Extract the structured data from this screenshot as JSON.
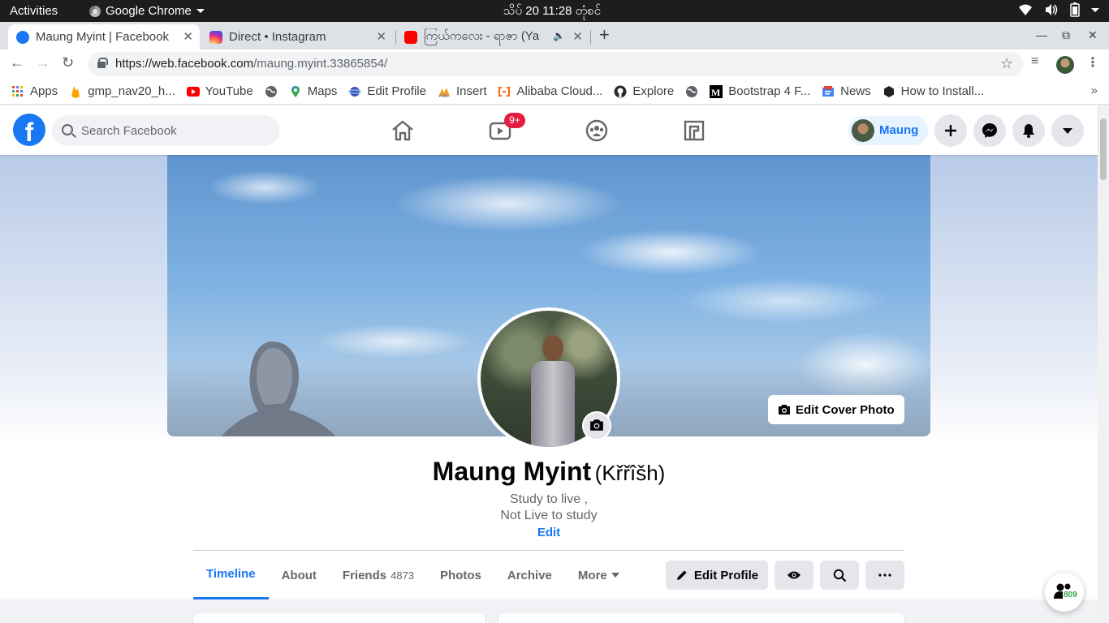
{
  "os_bar": {
    "activities": "Activities",
    "app_name": "Google Chrome",
    "clock": "သိပ် 20  11:28 တုံစင်"
  },
  "tabs": [
    {
      "title": "Maung Myint | Facebook",
      "active": true
    },
    {
      "title": "Direct • Instagram",
      "active": false
    },
    {
      "title": "ကြယ်ကလေး - ရာဇာ (Ya",
      "active": false
    }
  ],
  "address_bar": {
    "url_host": "https://web.facebook.com",
    "url_path": "/maung.myint.33865854/"
  },
  "bookmarks": [
    {
      "label": "Apps",
      "icon": "apps-grid-icon"
    },
    {
      "label": "gmp_nav20_h...",
      "icon": "firebase-icon"
    },
    {
      "label": "YouTube",
      "icon": "youtube-icon"
    },
    {
      "label": "",
      "icon": "globe-icon"
    },
    {
      "label": "Maps",
      "icon": "maps-pin-icon"
    },
    {
      "label": "Edit Profile",
      "icon": "globe-planet-icon"
    },
    {
      "label": "Insert",
      "icon": "pma-icon"
    },
    {
      "label": "Alibaba Cloud...",
      "icon": "alibaba-icon"
    },
    {
      "label": "Explore",
      "icon": "github-icon"
    },
    {
      "label": "",
      "icon": "globe-icon"
    },
    {
      "label": "Bootstrap 4 F...",
      "icon": "medium-icon"
    },
    {
      "label": "News",
      "icon": "google-news-icon"
    },
    {
      "label": "How to Install...",
      "icon": "hexagon-icon"
    }
  ],
  "facebook": {
    "search_placeholder": "Search Facebook",
    "watch_badge": "9+",
    "profile_chip_name": "Maung",
    "brand_color": "#1877f2",
    "profile": {
      "name": "Maung Myint",
      "alternate_name": "(Křřîšh)",
      "bio_line1": "Study to live ,",
      "bio_line2": "Not Live to study",
      "bio_edit": "Edit",
      "edit_cover_label": "Edit Cover Photo"
    },
    "profile_tabs": [
      {
        "label": "Timeline",
        "count": "",
        "active": true
      },
      {
        "label": "About",
        "count": ""
      },
      {
        "label": "Friends",
        "count": "4873"
      },
      {
        "label": "Photos",
        "count": ""
      },
      {
        "label": "Archive",
        "count": ""
      },
      {
        "label": "More",
        "count": ""
      }
    ],
    "edit_profile_label": "Edit Profile",
    "friends_fab_count": "809"
  }
}
